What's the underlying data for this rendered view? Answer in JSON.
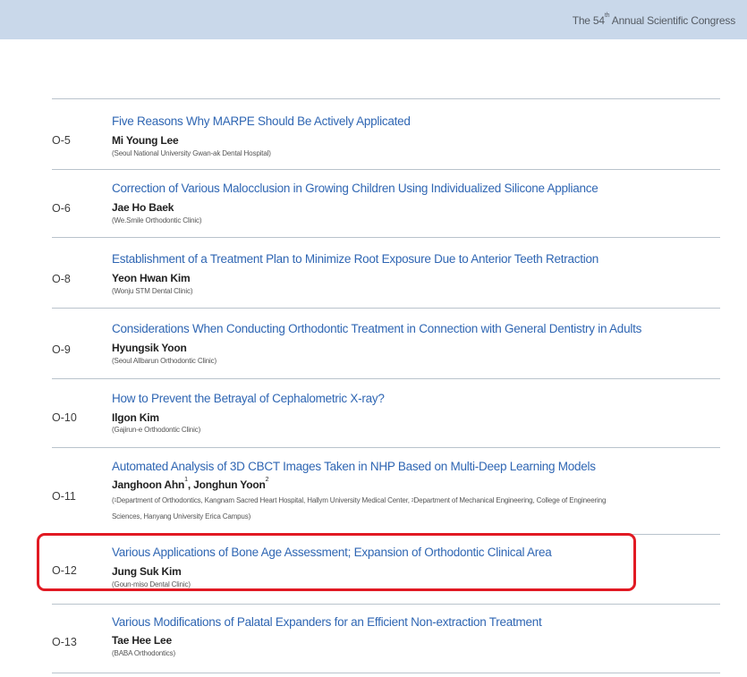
{
  "header": {
    "prefix": "The 54",
    "superscript": "th",
    "suffix": " Annual Scientific Congress"
  },
  "entries": [
    {
      "code": "O-5",
      "title": "Five Reasons Why MARPE Should Be Actively Applicated",
      "author": "Mi Young Lee",
      "affiliation": "(Seoul National University Gwan-ak Dental Hospital)"
    },
    {
      "code": "O-6",
      "title": "Correction of Various Malocclusion in Growing Children Using Individualized Silicone Appliance",
      "author": "Jae Ho Baek",
      "affiliation": "(We.Smile Orthodontic Clinic)"
    },
    {
      "code": "O-8",
      "title": "Establishment of a Treatment Plan to Minimize Root Exposure Due to Anterior Teeth Retraction",
      "author": "Yeon Hwan Kim",
      "affiliation": "(Wonju STM Dental Clinic)"
    },
    {
      "code": "O-9",
      "title": "Considerations When Conducting Orthodontic Treatment in Connection with General Dentistry in Adults",
      "author": "Hyungsik Yoon",
      "affiliation": "(Seoul Allbarun Orthodontic Clinic)"
    },
    {
      "code": "O-10",
      "title": "How to Prevent the Betrayal of Cephalometric X-ray?",
      "author": "Ilgon Kim",
      "affiliation": "(Gajirun-e Orthodontic Clinic)"
    },
    {
      "code": "O-11",
      "title": "Automated Analysis of 3D CBCT Images Taken in NHP Based on Multi-Deep Learning Models",
      "author1": "Janghoon Ahn",
      "author1_sup": "1",
      "author_sep": ", ",
      "author2": "Jonghun Yoon",
      "author2_sup": "2",
      "affil_line1_open": "(",
      "affil_sup1": "1",
      "affil_part1": "Department of Orthodontics, Kangnam Sacred Heart Hospital, Hallym University Medical Center, ",
      "affil_sup2": "2",
      "affil_part2": "Department of Mechanical Engineering, College of Engineering",
      "affil_line2": "Sciences, Hanyang University Erica Campus)"
    },
    {
      "code": "O-12",
      "title": "Various Applications of Bone Age Assessment; Expansion of Orthodontic Clinical Area",
      "author": "Jung Suk Kim",
      "affiliation": "(Goun-miso Dental Clinic)"
    },
    {
      "code": "O-13",
      "title": "Various Modifications of Palatal Expanders for an Efficient Non-extraction Treatment",
      "author": "Tae Hee Lee",
      "affiliation": "(BABA Orthodontics)"
    }
  ],
  "highlight": {
    "color": "#e11a23",
    "target_code": "O-12"
  }
}
